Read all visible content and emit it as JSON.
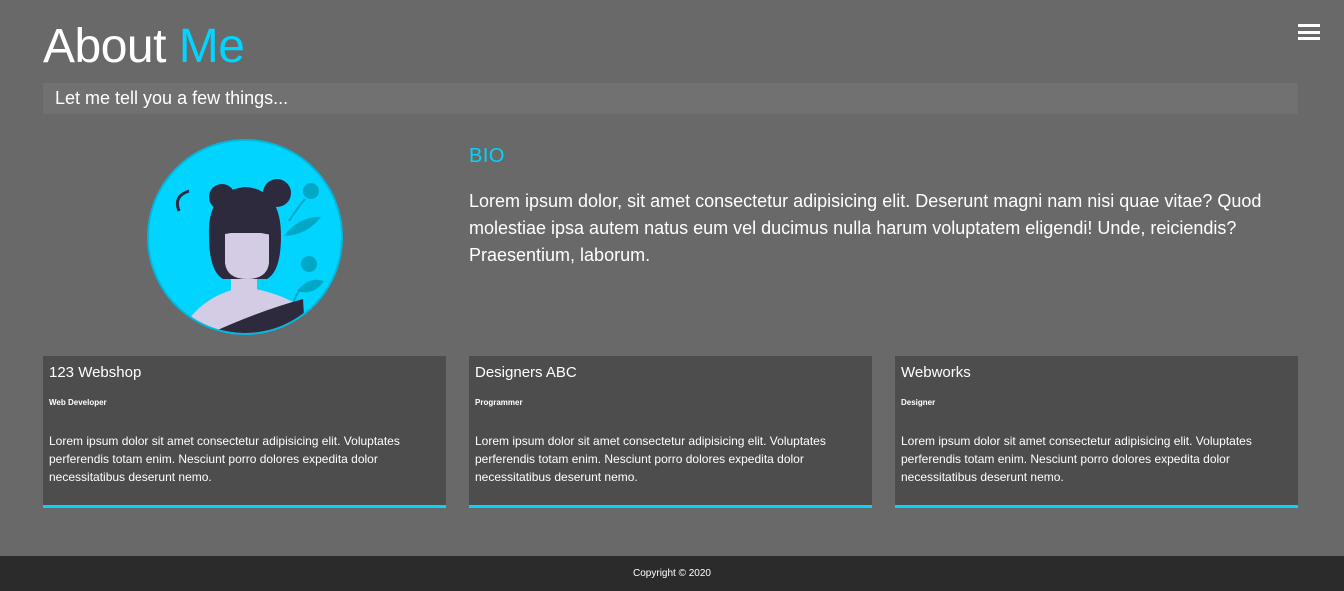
{
  "nav": {
    "menu_icon": "hamburger-menu-icon"
  },
  "header": {
    "title_main": "About",
    "title_accent": "Me",
    "tagline": "Let me tell you a few things..."
  },
  "avatar": {
    "icon": "avatar-illustration-icon"
  },
  "bio": {
    "heading": "BIO",
    "text": "Lorem ipsum dolor, sit amet consectetur adipisicing elit. Deserunt magni nam nisi quae vitae? Quod molestiae ipsa autem natus eum vel ducimus nulla harum voluptatem eligendi! Unde, reiciendis? Praesentium, laborum."
  },
  "jobs": [
    {
      "company": "123 Webshop",
      "role": "Web Developer",
      "description": "Lorem ipsum dolor sit amet consectetur adipisicing elit. Voluptates perferendis totam enim. Nesciunt porro dolores expedita dolor necessitatibus deserunt nemo."
    },
    {
      "company": "Designers ABC",
      "role": "Programmer",
      "description": "Lorem ipsum dolor sit amet consectetur adipisicing elit. Voluptates perferendis totam enim. Nesciunt porro dolores expedita dolor necessitatibus deserunt nemo."
    },
    {
      "company": "Webworks",
      "role": "Designer",
      "description": "Lorem ipsum dolor sit amet consectetur adipisicing elit. Voluptates perferendis totam enim. Nesciunt porro dolores expedita dolor necessitatibus deserunt nemo."
    }
  ],
  "footer": {
    "copyright": "Copyright © 2020"
  },
  "colors": {
    "accent": "#00d4ff",
    "background": "#696969",
    "card": "#4d4d4d",
    "footer": "#2b2b2b"
  }
}
